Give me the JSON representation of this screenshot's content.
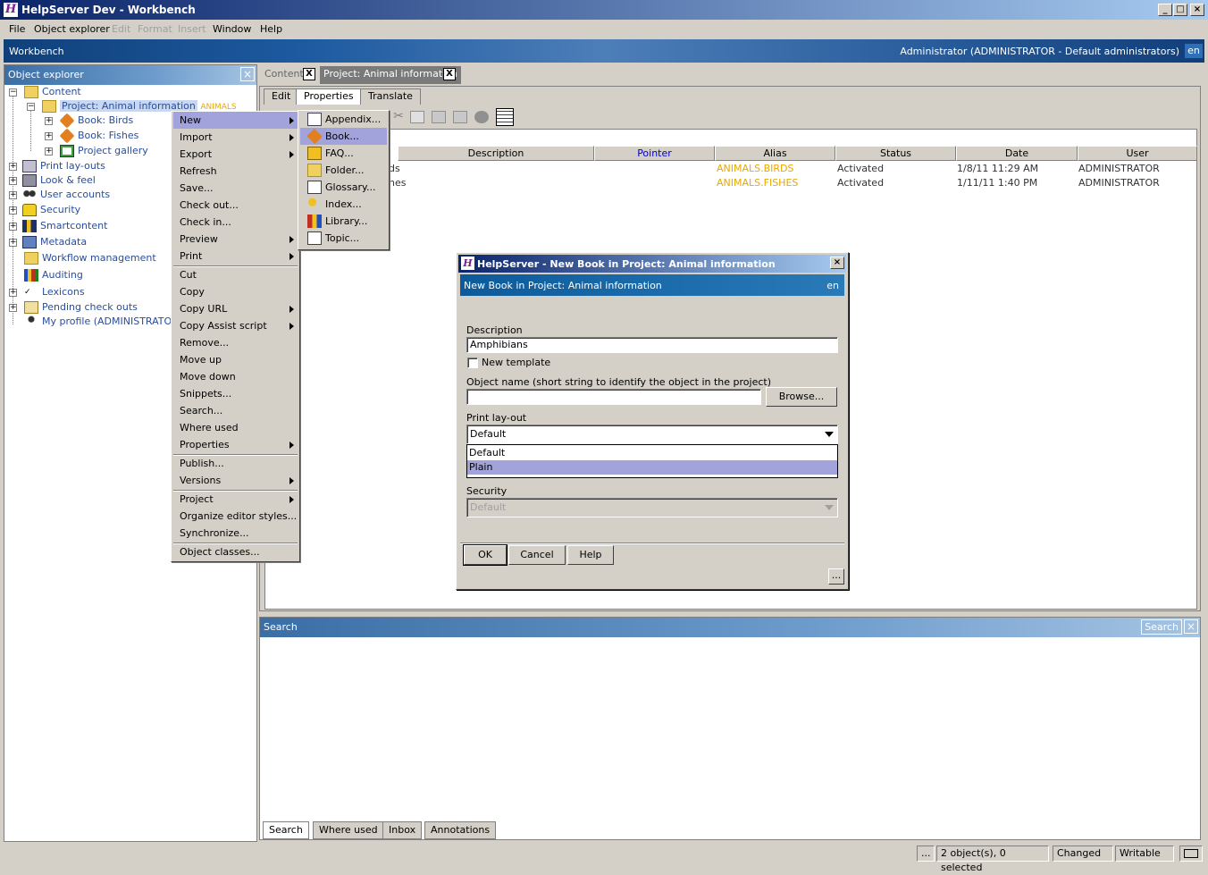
{
  "window": {
    "title": "HelpServer Dev - Workbench",
    "min": "_",
    "max": "□",
    "close": "×"
  },
  "menubar": [
    "File",
    "Object explorer",
    "Edit",
    "Format",
    "Insert",
    "Window",
    "Help"
  ],
  "banner": {
    "label": "Workbench",
    "user": "Administrator (ADMINISTRATOR - Default administrators)",
    "lang": "en"
  },
  "explorer": {
    "title": "Object explorer",
    "tree": {
      "content": "Content",
      "project": "Project: Animal information",
      "project_alias": "ANIMALS",
      "birds": "Book: Birds",
      "fishes": "Book: Fishes",
      "gallery": "Project gallery",
      "print_layouts": "Print lay-outs",
      "look_feel": "Look & feel",
      "user_accounts": "User accounts",
      "security": "Security",
      "smartcontent": "Smartcontent",
      "metadata": "Metadata",
      "workflow": "Workflow management",
      "auditing": "Auditing",
      "lexicons": "Lexicons",
      "pending": "Pending check outs",
      "profile": "My profile (ADMINISTRATOR)"
    }
  },
  "doc_tabs": {
    "content": "Content",
    "project": "Project: Animal information"
  },
  "inner_tabs": {
    "edit": "Edit",
    "properties": "Properties",
    "translate": "Translate"
  },
  "grid": {
    "columns": [
      "Description",
      "Pointer",
      "Alias",
      "Status",
      "Date",
      "User"
    ],
    "rows": [
      {
        "desc": "ds",
        "alias": "ANIMALS.BIRDS",
        "status": "Activated",
        "date": "1/8/11 11:29 AM",
        "user": "ADMINISTRATOR"
      },
      {
        "desc": "nes",
        "alias": "ANIMALS.FISHES",
        "status": "Activated",
        "date": "1/11/11 1:40 PM",
        "user": "ADMINISTRATOR"
      }
    ]
  },
  "search_panel": {
    "title": "Search",
    "button": "Search"
  },
  "bottom_tabs": [
    "Search",
    "Where used",
    "Inbox",
    "Annotations"
  ],
  "status": {
    "dots": "...",
    "selection": "2 object(s), 0 selected",
    "changed": "Changed",
    "writable": "Writable"
  },
  "context_menu": [
    "New",
    "Import",
    "Export",
    "Refresh",
    "Save...",
    "Check out...",
    "Check in...",
    "Preview",
    "Print",
    "Cut",
    "Copy",
    "Copy URL",
    "Copy Assist script",
    "Remove...",
    "Move up",
    "Move down",
    "Snippets...",
    "Search...",
    "Where used",
    "Properties",
    "Publish...",
    "Versions",
    "Project",
    "Organize editor styles...",
    "Synchronize...",
    "Object classes..."
  ],
  "submenu": [
    "Appendix...",
    "Book...",
    "FAQ...",
    "Folder...",
    "Glossary...",
    "Index...",
    "Library...",
    "Topic..."
  ],
  "dialog": {
    "title": "HelpServer - New Book in Project: Animal information",
    "banner": "New Book in Project: Animal information",
    "lang": "en",
    "description_label": "Description",
    "description_value": "Amphibians",
    "new_template": "New template",
    "objname_label": "Object name (short string to identify the object in the project)",
    "objname_value": "",
    "browse": "Browse...",
    "print_label": "Print lay-out",
    "print_value": "Default",
    "print_options": [
      "Default",
      "Plain"
    ],
    "security_label": "Security",
    "security_value": "Default",
    "ok": "OK",
    "cancel": "Cancel",
    "help": "Help",
    "more": "..."
  },
  "colors": {
    "highlight": "#a3a3dc",
    "link": "#2a4d9a",
    "alias": "#e8a800",
    "titlebar": "#0a246a"
  }
}
